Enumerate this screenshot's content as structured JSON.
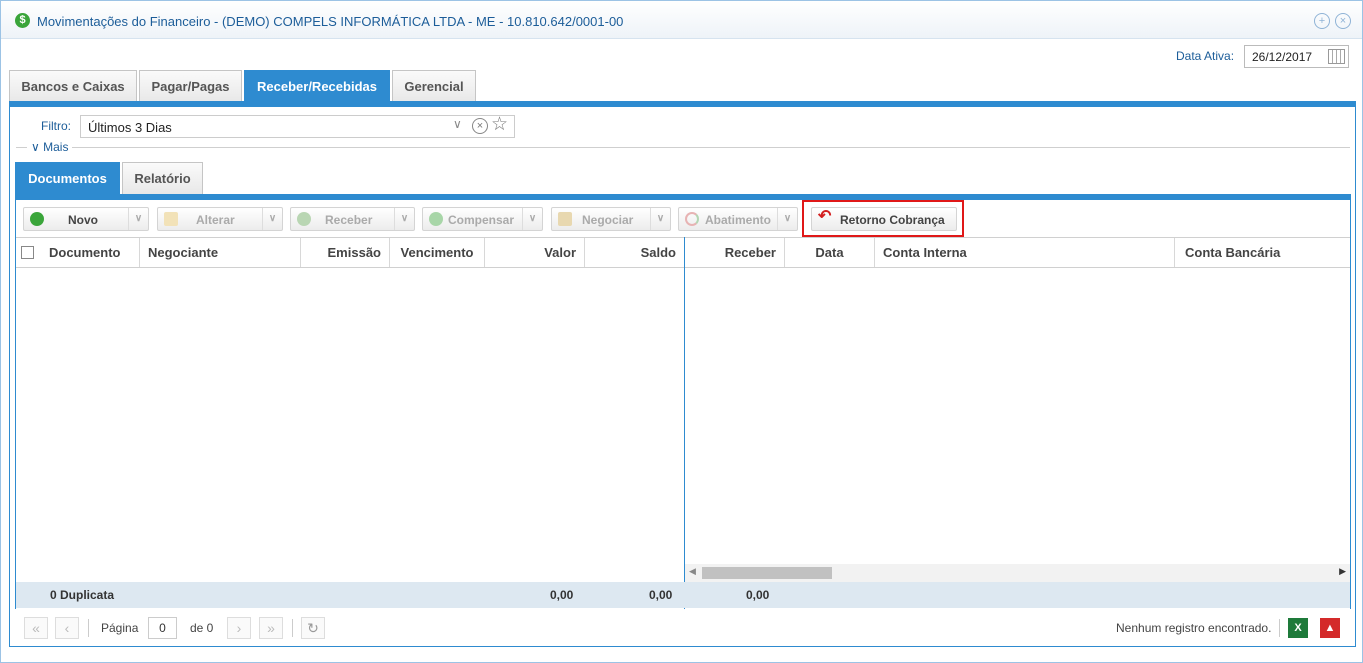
{
  "window": {
    "title": "Movimentações do Financeiro - (DEMO) COMPELS INFORMÁTICA LTDA - ME - 10.810.642/0001-00",
    "title_icon": "dollar-icon",
    "buttons": [
      "expand-icon",
      "close-icon"
    ]
  },
  "data_ativa": {
    "label": "Data Ativa:",
    "value": "26/12/2017"
  },
  "main_tabs": [
    {
      "label": "Bancos e Caixas"
    },
    {
      "label": "Pagar/Pagas"
    },
    {
      "label": "Receber/Recebidas",
      "active": true
    },
    {
      "label": "Gerencial"
    }
  ],
  "filtro": {
    "label": "Filtro:",
    "value": "Últimos 3 Dias",
    "mais": "Mais"
  },
  "sub_tabs": [
    {
      "label": "Documentos",
      "active": true
    },
    {
      "label": "Relatório"
    }
  ],
  "toolbar": {
    "novo": "Novo",
    "alterar": "Alterar",
    "receber": "Receber",
    "compensar": "Compensar",
    "negociar": "Negociar",
    "abatimento": "Abatimento",
    "retorno": "Retorno Cobrança"
  },
  "columns_left": [
    "Documento",
    "Negociante",
    "Emissão",
    "Vencimento",
    "Valor",
    "Saldo"
  ],
  "columns_right": [
    "Receber",
    "Data",
    "Conta Interna",
    "Conta Bancária"
  ],
  "totals": {
    "count_label": "0 Duplicata",
    "valor": "0,00",
    "saldo": "0,00",
    "receber": "0,00"
  },
  "pager": {
    "page_label": "Página",
    "page_value": "0",
    "of_label": "de 0",
    "status": "Nenhum registro encontrado."
  },
  "colors": {
    "accent": "#2e8bd0",
    "title": "#1c5d99",
    "highlight": "#e01818"
  }
}
